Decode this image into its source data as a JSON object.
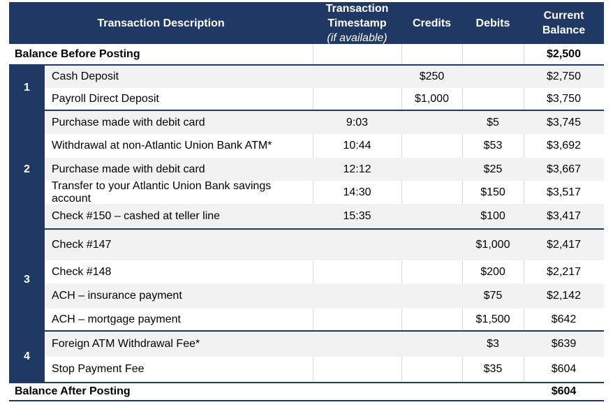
{
  "headers": {
    "description": "Transaction Description",
    "timestamp_line1": "Transaction",
    "timestamp_line2": "Timestamp",
    "timestamp_note": "(if available)",
    "credits": "Credits",
    "debits": "Debits",
    "balance_line1": "Current",
    "balance_line2": "Balance"
  },
  "balance_before": {
    "label": "Balance Before Posting",
    "balance": "$2,500"
  },
  "groups": [
    {
      "label": "1",
      "rows": [
        {
          "description": "Cash Deposit",
          "timestamp": "",
          "credit": "$250",
          "debit": "",
          "balance": "$2,750"
        },
        {
          "description": "Payroll Direct Deposit",
          "timestamp": "",
          "credit": "$1,000",
          "debit": "",
          "balance": "$3,750"
        }
      ]
    },
    {
      "label": "2",
      "rows": [
        {
          "description": "Purchase made with debit card",
          "timestamp": "9:03",
          "credit": "",
          "debit": "$5",
          "balance": "$3,745"
        },
        {
          "description": "Withdrawal at non-Atlantic Union Bank ATM*",
          "timestamp": "10:44",
          "credit": "",
          "debit": "$53",
          "balance": "$3,692"
        },
        {
          "description": "Purchase made with debit card",
          "timestamp": "12:12",
          "credit": "",
          "debit": "$25",
          "balance": "$3,667"
        },
        {
          "description": "Transfer to your Atlantic Union Bank savings account",
          "timestamp": "14:30",
          "credit": "",
          "debit": "$150",
          "balance": "$3,517"
        },
        {
          "description": "Check #150 – cashed at teller line",
          "timestamp": "15:35",
          "credit": "",
          "debit": "$100",
          "balance": "$3,417"
        }
      ]
    },
    {
      "label": "3",
      "rows": [
        {
          "description": "Check #147",
          "timestamp": "",
          "credit": "",
          "debit": "$1,000",
          "balance": "$2,417"
        },
        {
          "description": "Check #148",
          "timestamp": "",
          "credit": "",
          "debit": "$200",
          "balance": "$2,217"
        },
        {
          "description": "ACH – insurance payment",
          "timestamp": "",
          "credit": "",
          "debit": "$75",
          "balance": "$2,142"
        },
        {
          "description": "ACH – mortgage payment",
          "timestamp": "",
          "credit": "",
          "debit": "$1,500",
          "balance": "$642"
        }
      ]
    },
    {
      "label": "4",
      "rows": [
        {
          "description": "Foreign ATM Withdrawal Fee*",
          "timestamp": "",
          "credit": "",
          "debit": "$3",
          "balance": "$639"
        },
        {
          "description": "Stop Payment Fee",
          "timestamp": "",
          "credit": "",
          "debit": "$35",
          "balance": "$604"
        }
      ]
    }
  ],
  "balance_after": {
    "label": "Balance After Posting",
    "balance": "$604"
  }
}
